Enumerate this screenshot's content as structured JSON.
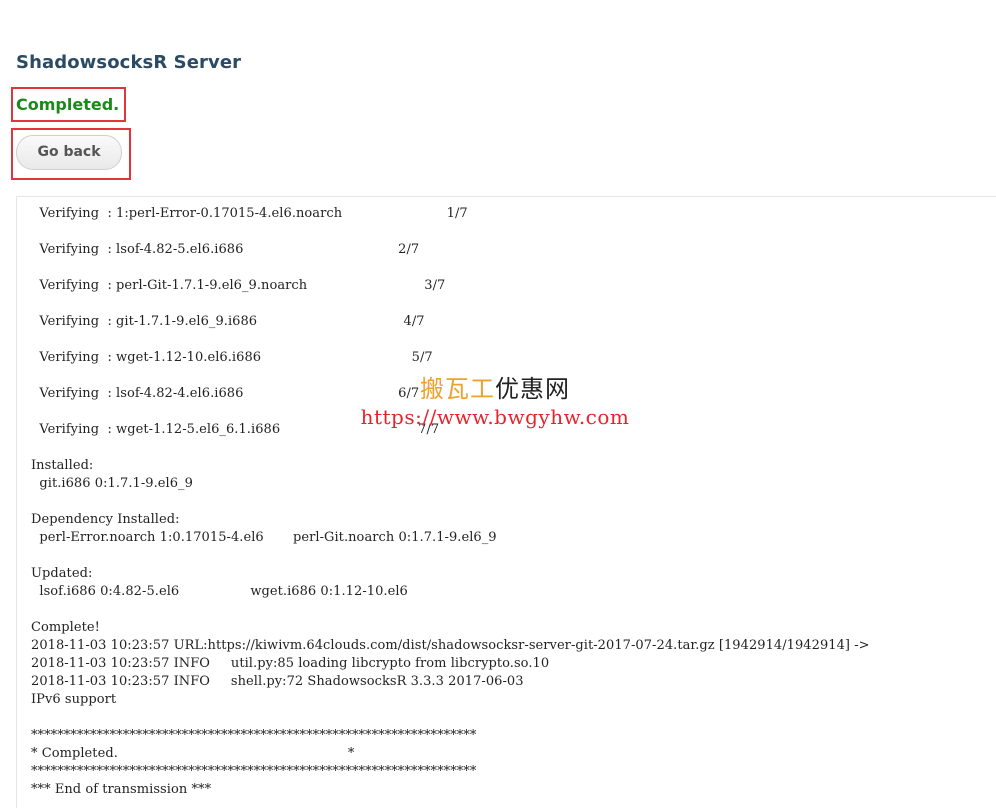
{
  "page": {
    "title": "ShadowsocksR Server",
    "status": "Completed.",
    "back_label": "Go back"
  },
  "console": {
    "output": "  Verifying  : 1:perl-Error-0.17015-4.el6.noarch                         1/7\n\n  Verifying  : lsof-4.82-5.el6.i686                                     2/7\n\n  Verifying  : perl-Git-1.7.1-9.el6_9.noarch                            3/7\n\n  Verifying  : git-1.7.1-9.el6_9.i686                                   4/7\n\n  Verifying  : wget-1.12-10.el6.i686                                    5/7\n\n  Verifying  : lsof-4.82-4.el6.i686                                     6/7\n\n  Verifying  : wget-1.12-5.el6_6.1.i686                                 7/7\n\nInstalled:\n  git.i686 0:1.7.1-9.el6_9\n\nDependency Installed:\n  perl-Error.noarch 1:0.17015-4.el6       perl-Git.noarch 0:1.7.1-9.el6_9\n\nUpdated:\n  lsof.i686 0:4.82-5.el6                 wget.i686 0:1.12-10.el6\n\nComplete!\n2018-11-03 10:23:57 URL:https://kiwivm.64clouds.com/dist/shadowsocksr-server-git-2017-07-24.tar.gz [1942914/1942914] ->\n2018-11-03 10:23:57 INFO     util.py:85 loading libcrypto from libcrypto.so.10\n2018-11-03 10:23:57 INFO     shell.py:72 ShadowsocksR 3.3.3 2017-06-03\nIPv6 support\n\n********************************************************************\n* Completed.                                                       *\n********************************************************************\n*** End of transmission ***"
  },
  "watermark": {
    "name_part1": "搬瓦工",
    "name_part2": "优惠网",
    "url": "https://www.bwgyhw.com"
  },
  "colors": {
    "title": "#2b4a63",
    "status": "#1a8a1a",
    "highlight_box": "#e0353b",
    "watermark_orange": "#f0a12d",
    "watermark_red": "#e8222a"
  }
}
